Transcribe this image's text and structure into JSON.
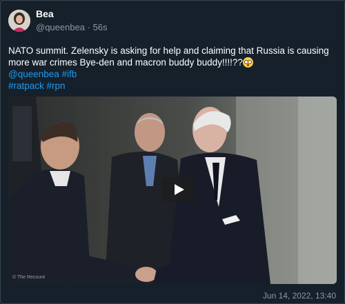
{
  "author": {
    "name": "Bea",
    "handle": "@queenbea",
    "separator": "·",
    "time_ago": "56s"
  },
  "post": {
    "text": "NATO summit. Zelensky is asking for help and claiming that Russia is causing more war crimes Bye-den and macron buddy buddy!!!!??",
    "emoji": "flushed-face-emoji",
    "mention": "@queenbea",
    "hashtags": [
      "#ifb",
      "#ratpack",
      "#rpn"
    ]
  },
  "media": {
    "type": "video",
    "watermark": "© The Recount"
  },
  "timestamp": "Jun 14, 2022, 13:40",
  "colors": {
    "background": "#15202b",
    "link": "#1d9bf0",
    "muted": "#8b98a5",
    "border": "#38444d"
  }
}
